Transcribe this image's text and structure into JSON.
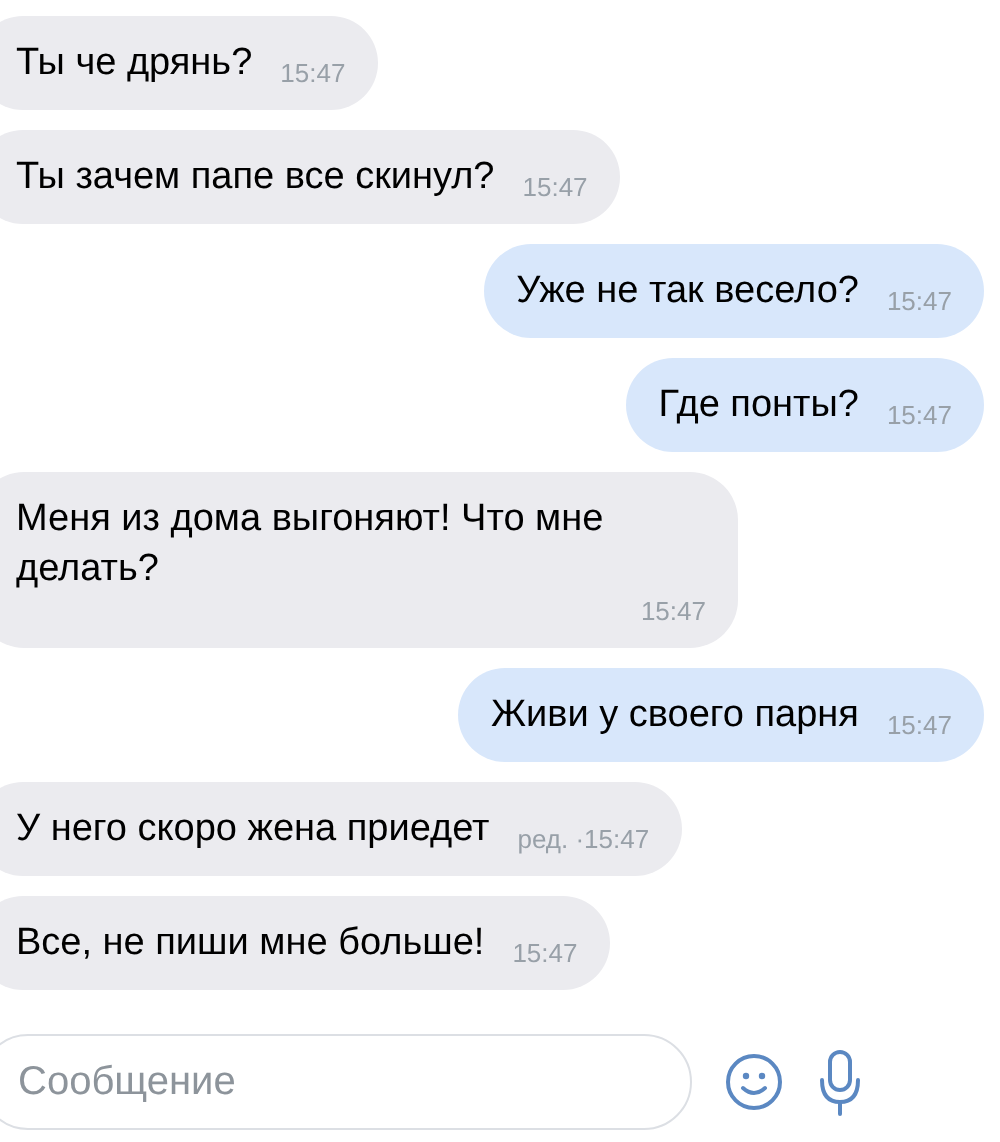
{
  "messages": [
    {
      "kind": "incoming",
      "text": "Ты че дрянь?",
      "time": "15:47"
    },
    {
      "kind": "incoming",
      "text": "Ты зачем папе все скинул?",
      "time": "15:47"
    },
    {
      "kind": "outgoing",
      "text": "Уже не так весело?",
      "time": "15:47"
    },
    {
      "kind": "outgoing",
      "text": "Где понты?",
      "time": "15:47"
    },
    {
      "kind": "incoming",
      "text": "Меня из дома выгоняют! Что мне делать?",
      "time": "15:47"
    },
    {
      "kind": "outgoing",
      "text": "Живи у своего парня",
      "time": "15:47"
    },
    {
      "kind": "incoming",
      "text": "У него скоро жена приедет",
      "edited": "ред. ·",
      "time": "15:47"
    },
    {
      "kind": "incoming",
      "text": "Все, не пиши мне больше!",
      "time": "15:47"
    }
  ],
  "composer": {
    "placeholder": "Сообщение"
  }
}
